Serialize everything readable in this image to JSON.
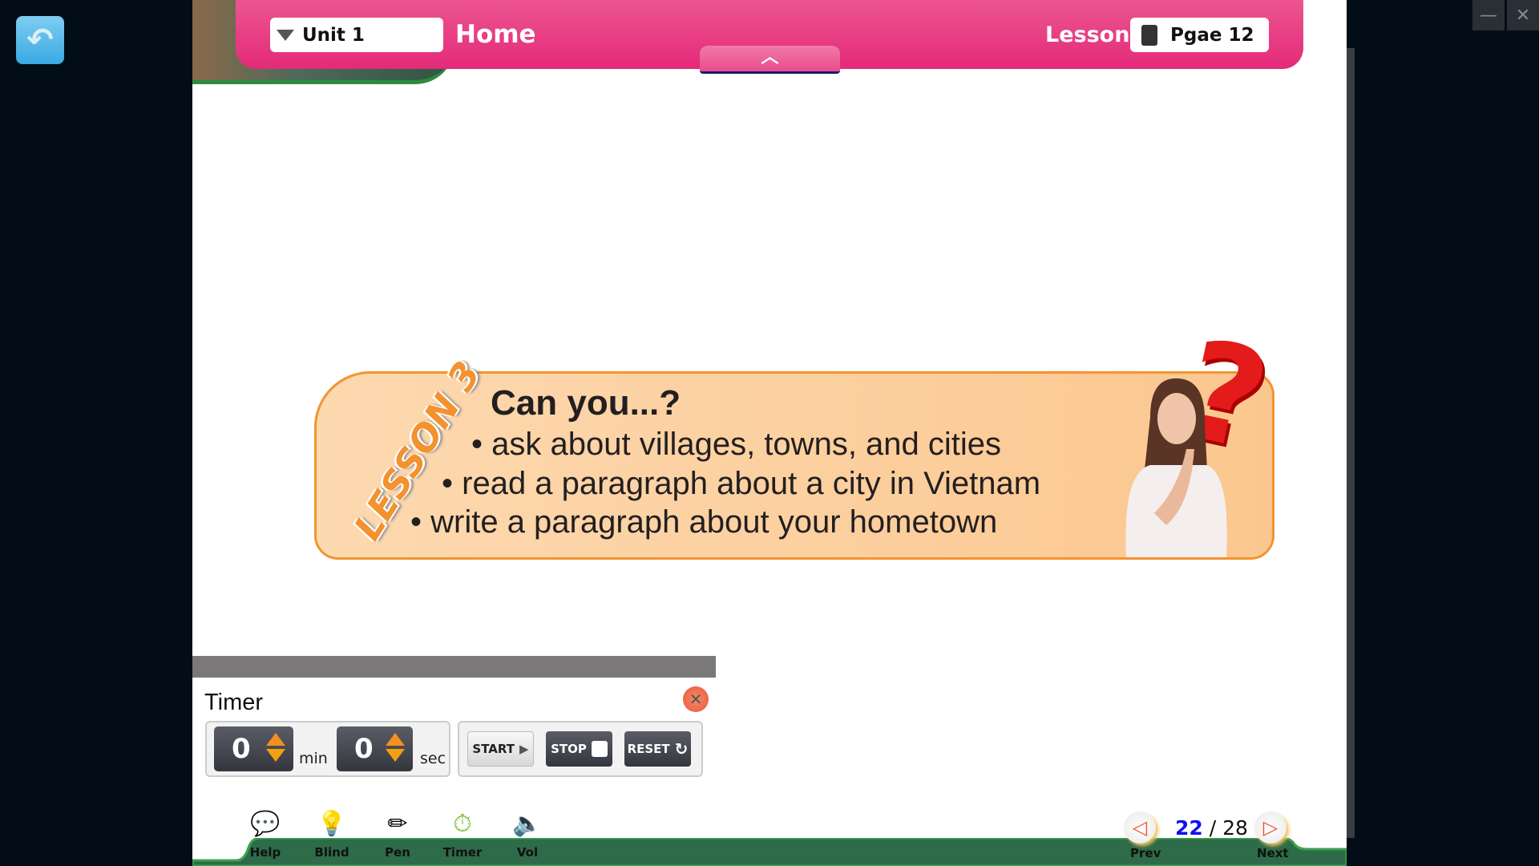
{
  "header": {
    "unit": "Unit 1",
    "title": "Home",
    "lesson_label": "Lesson",
    "page": "Pgae 12",
    "collapse_icon": "chevron-up-icon"
  },
  "banner": {
    "lesson_tag": "LESSON 3",
    "heading": "Can you...?",
    "bullets": [
      "ask about villages, towns, and cities",
      "read a paragraph about a city in Vietnam",
      "write a paragraph about your hometown"
    ]
  },
  "timer": {
    "title": "Timer",
    "minutes": "0",
    "min_label": "min",
    "seconds": "0",
    "sec_label": "sec",
    "start": "START",
    "stop": "STOP",
    "reset": "RESET"
  },
  "toolbar": {
    "items": [
      {
        "label": "Help",
        "icon": "speech-bubble-icon"
      },
      {
        "label": "Blind",
        "icon": "lightbulb-icon"
      },
      {
        "label": "Pen",
        "icon": "pencil-icon"
      },
      {
        "label": "Timer",
        "icon": "stopwatch-icon"
      },
      {
        "label": "Vol",
        "icon": "speaker-icon"
      }
    ]
  },
  "pagination": {
    "current": "22",
    "total": "/ 28",
    "prev": "Prev",
    "next": "Next"
  },
  "colors": {
    "header_pink": "#e84585",
    "banner_orange": "#f39432",
    "toolbar_green": "#2e6b48",
    "current_page": "#1010ee"
  }
}
